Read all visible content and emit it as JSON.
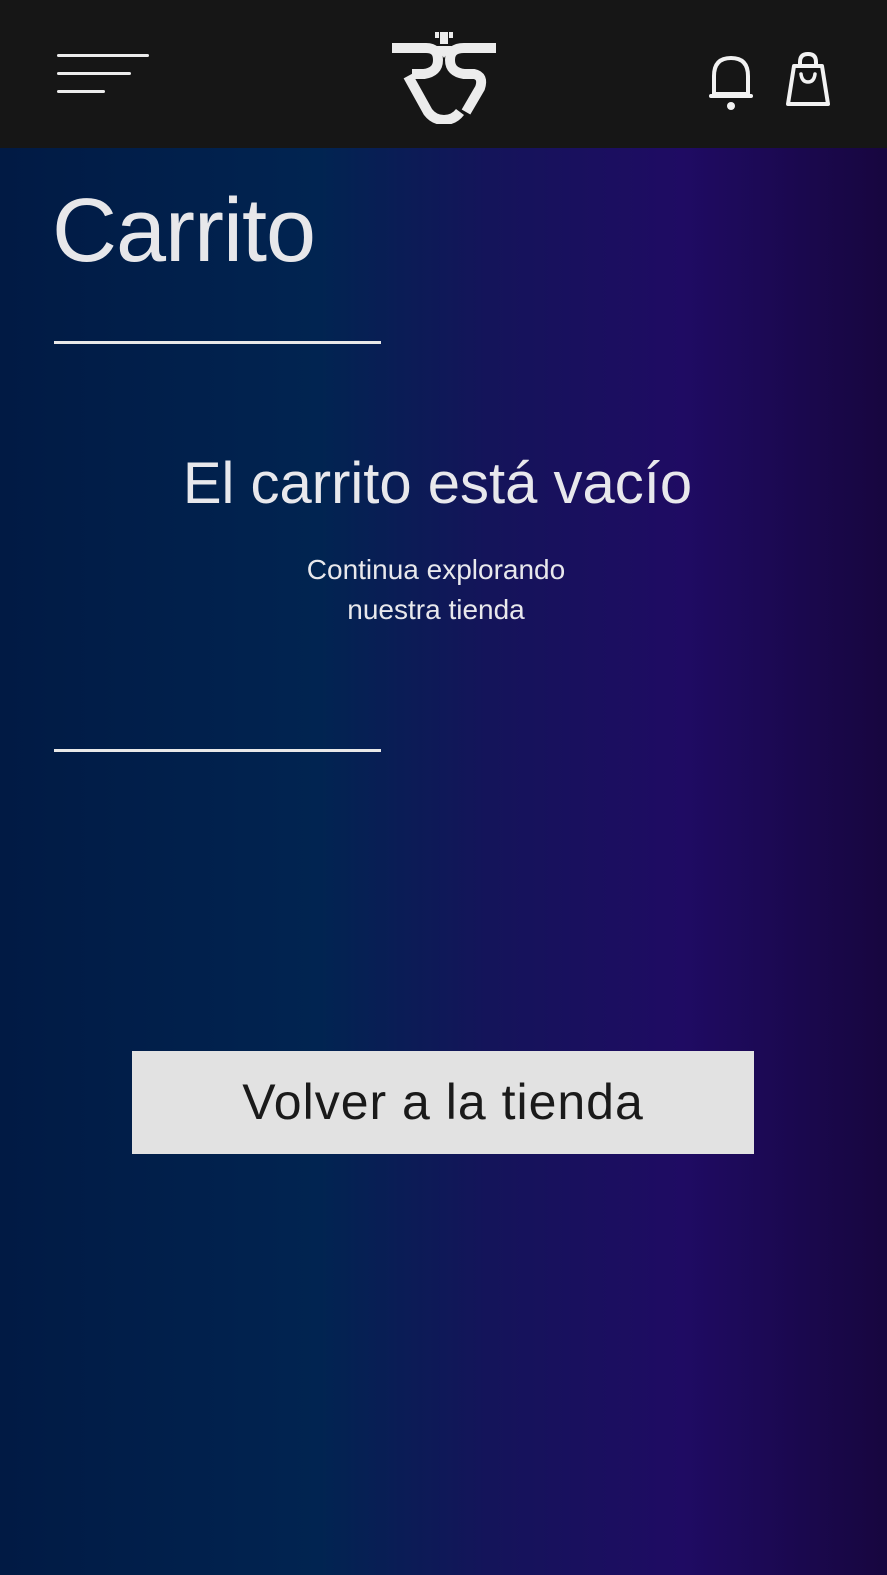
{
  "header": {
    "menu_icon": "hamburger-menu-icon",
    "logo_icon": "brand-logo-icon",
    "notification_icon": "bell-icon",
    "cart_icon": "shopping-bag-icon",
    "background_color": "#161616"
  },
  "page": {
    "title": "Carrito",
    "empty_title": "El carrito está vacío",
    "empty_subtitle_line1": "Continua explorando",
    "empty_subtitle_line2": "nuestra tienda",
    "back_button_label": "Volver a la tienda"
  },
  "colors": {
    "text_light": "#e8e8ec",
    "button_bg": "#e2e2e2",
    "button_text": "#1a1a1a",
    "gradient_start": "#011a44",
    "gradient_end": "#17063f"
  }
}
